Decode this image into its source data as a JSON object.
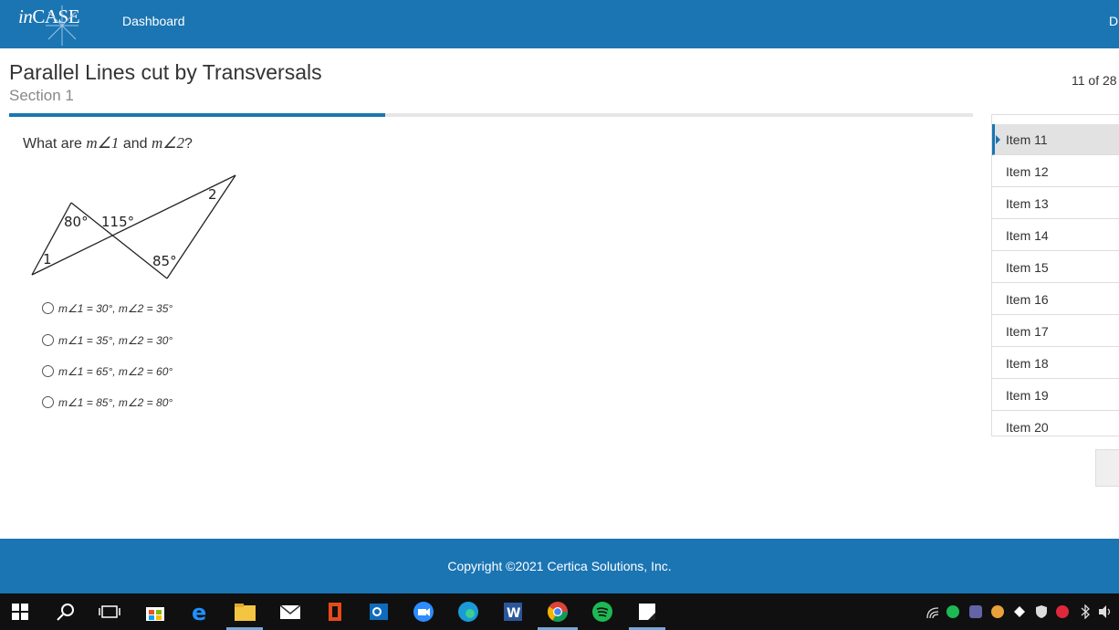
{
  "header": {
    "logo_prefix": "in",
    "logo_main": "CASE",
    "nav_dashboard": "Dashboard",
    "nav_right_partial": "D"
  },
  "assessment": {
    "title": "Parallel Lines cut by Transversals",
    "section": "Section 1",
    "counter": "11 of 28",
    "progress_fraction": 0.39
  },
  "question": {
    "prefix": "What are ",
    "m1": "m∠1",
    "and": " and ",
    "m2": "m∠2",
    "suffix": "?"
  },
  "figure_labels": {
    "angle_80": "80°",
    "angle_115": "115°",
    "angle_85": "85°",
    "angle_1": "1",
    "angle_2": "2"
  },
  "choices": [
    "m∠1 = 30°, m∠2 = 35°",
    "m∠1 = 35°, m∠2 = 30°",
    "m∠1 = 65°, m∠2 = 60°",
    "m∠1 = 85°, m∠2 = 80°"
  ],
  "sidebar": {
    "items": [
      "Item 11",
      "Item 12",
      "Item 13",
      "Item 14",
      "Item 15",
      "Item 16",
      "Item 17",
      "Item 18",
      "Item 19",
      "Item 20"
    ],
    "active_index": 0
  },
  "footer": {
    "copyright": "Copyright ©2021 Certica Solutions, Inc."
  },
  "taskbar": {
    "icons": [
      "windows-start-icon",
      "search-icon",
      "task-view-icon",
      "store-icon",
      "edge-legacy-icon",
      "file-explorer-icon",
      "mail-icon",
      "office-icon",
      "outlook-icon",
      "zoom-icon",
      "edge-icon",
      "word-icon",
      "chrome-icon",
      "spotify-icon",
      "sticky-notes-icon"
    ],
    "active": [
      "file-explorer-icon",
      "chrome-icon",
      "sticky-notes-icon"
    ]
  },
  "colors": {
    "brand_blue": "#1b75b3",
    "taskbar": "#101010"
  }
}
